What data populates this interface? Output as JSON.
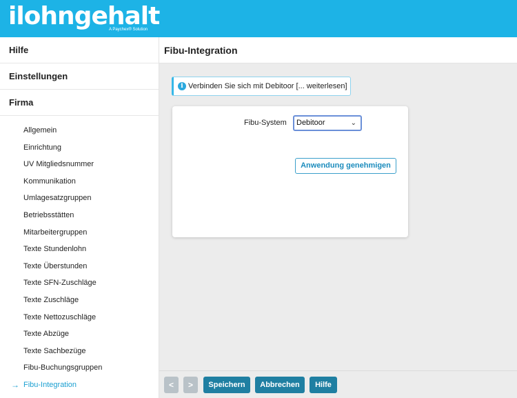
{
  "header": {
    "logo_text": "ilohngehalt",
    "logo_subtitle": "A Paychex® Solution"
  },
  "sidebar": {
    "top_items": [
      "Hilfe",
      "Einstellungen",
      "Firma"
    ],
    "sub_items": [
      {
        "label": "Allgemein"
      },
      {
        "label": "Einrichtung"
      },
      {
        "label": "UV Mitgliedsnummer"
      },
      {
        "label": "Kommunikation"
      },
      {
        "label": "Umlagesatzgruppen"
      },
      {
        "label": "Betriebsstätten"
      },
      {
        "label": "Mitarbeitergruppen"
      },
      {
        "label": "Texte Stundenlohn"
      },
      {
        "label": "Texte Überstunden"
      },
      {
        "label": "Texte SFN-Zuschläge"
      },
      {
        "label": "Texte Zuschläge"
      },
      {
        "label": "Texte Nettozuschläge"
      },
      {
        "label": "Texte Abzüge"
      },
      {
        "label": "Texte Sachbezüge"
      },
      {
        "label": "Fibu-Buchungsgruppen"
      },
      {
        "label": "Fibu-Integration",
        "active": true
      }
    ],
    "active_arrow": "→"
  },
  "main": {
    "title": "Fibu-Integration",
    "info_text": "Verbinden Sie sich mit Debitoor [... weiterlesen]",
    "info_icon_glyph": "i",
    "form": {
      "fibu_label": "Fibu-System",
      "fibu_value": "Debitoor",
      "chevron_glyph": "⌄",
      "approve_label": "Anwendung genehmigen"
    }
  },
  "footer": {
    "prev_label": "<",
    "next_label": ">",
    "save_label": "Speichern",
    "cancel_label": "Abbrechen",
    "help_label": "Hilfe"
  },
  "colors": {
    "brand": "#1db3e6",
    "active_link": "#1a9fd1",
    "primary_button": "#1f7fa2",
    "nav_button": "#b9c2c8"
  }
}
